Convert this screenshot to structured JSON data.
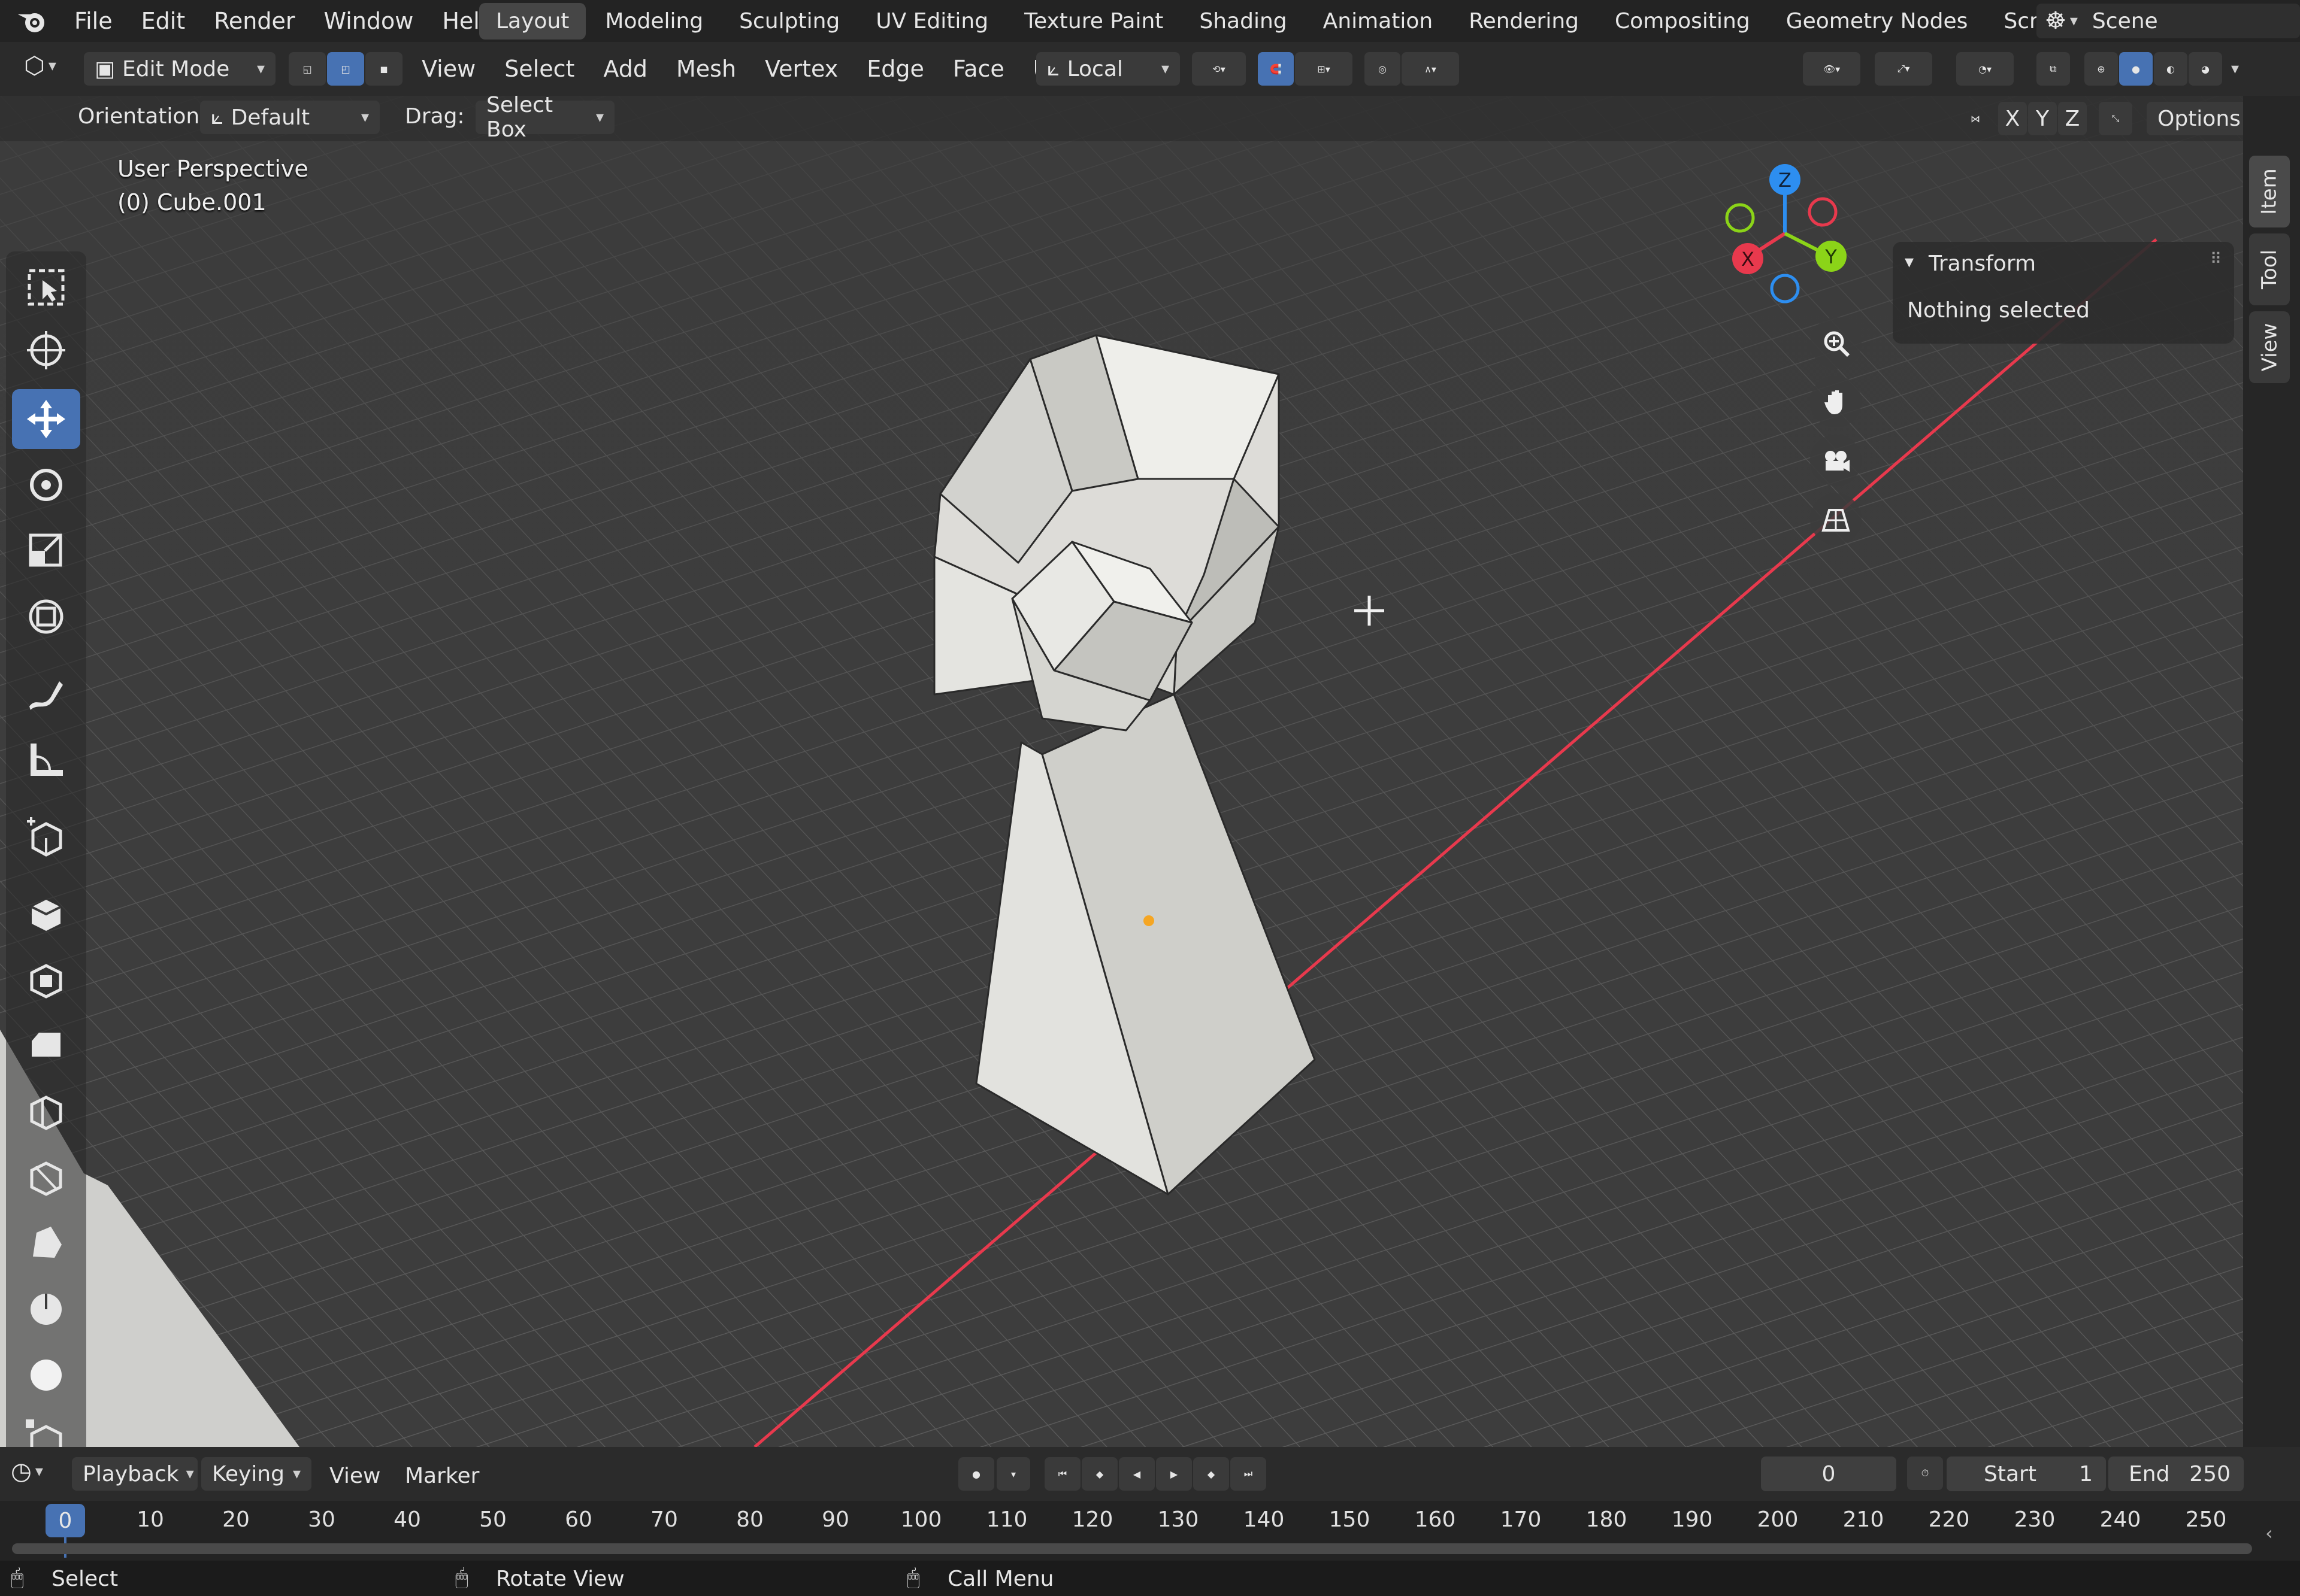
{
  "topbar": {
    "menus": [
      "File",
      "Edit",
      "Render",
      "Window",
      "Help"
    ],
    "workspaces": [
      "Layout",
      "Modeling",
      "Sculpting",
      "UV Editing",
      "Texture Paint",
      "Shading",
      "Animation",
      "Rendering",
      "Compositing",
      "Geometry Nodes",
      "Scripting"
    ],
    "active_workspace": "Layout",
    "scene_label": "Scene"
  },
  "header": {
    "mode": "Edit Mode",
    "menus": [
      "View",
      "Select",
      "Add",
      "Mesh",
      "Vertex",
      "Edge",
      "Face",
      "UV"
    ],
    "transform_orientation": "Local"
  },
  "toolsettings": {
    "orientation_label": "Orientation:",
    "orientation_value": "Default",
    "drag_label": "Drag:",
    "drag_value": "Select Box",
    "axes": [
      "X",
      "Y",
      "Z"
    ],
    "options_label": "Options"
  },
  "viewport": {
    "perspective_label": "User Perspective",
    "object_label": "(0) Cube.001",
    "gizmo_axes": [
      "Z",
      "X",
      "Y"
    ]
  },
  "npanel": {
    "title": "Transform",
    "message": "Nothing selected",
    "tabs": [
      "Item",
      "Tool",
      "View"
    ]
  },
  "timeline": {
    "menus": [
      "Playback",
      "Keying",
      "View",
      "Marker"
    ],
    "current_frame": "0",
    "start_label": "Start",
    "start_value": "1",
    "end_label": "End",
    "end_value": "250",
    "playhead": "0",
    "ruler_ticks": [
      "10",
      "20",
      "30",
      "40",
      "50",
      "60",
      "70",
      "80",
      "90",
      "100",
      "110",
      "120",
      "130",
      "140",
      "150",
      "160",
      "170",
      "180",
      "190",
      "200",
      "210",
      "220",
      "230",
      "240",
      "250"
    ]
  },
  "statusbar": {
    "select": "Select",
    "rotate": "Rotate View",
    "call_menu": "Call Menu"
  },
  "colors": {
    "accent": "#4772b3",
    "x_axis": "#e8394d",
    "y_axis": "#8bd418",
    "z_axis": "#2d8ef0",
    "viewport_bg": "#3c3c3c",
    "mesh_face": "#d8d8d3"
  }
}
